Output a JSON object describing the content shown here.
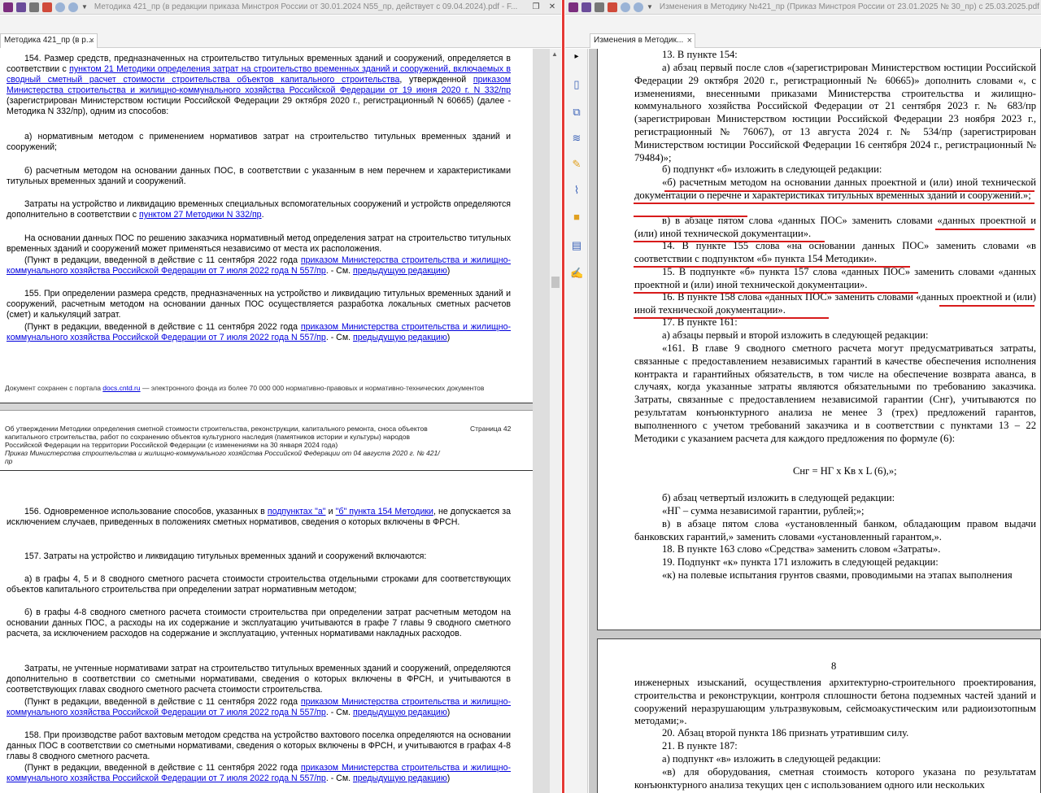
{
  "left_window": {
    "title": "Методика 421_пр (в редакции приказа Минстроя России от 30.01.2024 N55_пр, действует с 09.04.2024).pdf - F...",
    "tab_label": "Методика 421_пр (в р...",
    "tab_close": "×"
  },
  "right_window": {
    "title": "Изменения в Методику №421_пр (Приказ Минстроя России от 23.01.2025 № 30_пр) с 25.03.2025.pdf - Fo...",
    "tab_label": "Изменения в Методик...",
    "tab_close": "×"
  },
  "window_buttons": {
    "restore": "❐",
    "close": "✕"
  },
  "icons": {
    "app": "foxit-app-icon",
    "save": "save-icon",
    "print": "print-icon",
    "undo": "undo-icon",
    "redo": "redo-icon",
    "customize": "chevron-down-icon",
    "expand": "chevron-right-icon",
    "tools": [
      "page-icon",
      "pages-icon",
      "layers-icon",
      "comments-icon",
      "attachment-icon",
      "lock-icon",
      "form-icon",
      "signature-icon"
    ]
  },
  "left_doc": {
    "p154_a": "154. Размер средств, предназначенных на строительство титульных временных зданий и сооружений, определяется в соответствии с ",
    "p154_link1": "пунктом 21 Методики определения затрат на строительство временных зданий и сооружений, включаемых в сводный сметный расчет стоимости строительства объектов капитального строительства",
    "p154_b": ", утвержденной ",
    "p154_link2": "приказом Министерства строительства и жилищно-коммунального хозяйства Российской Федерации от 19 июня 2020 г. N 332/пр",
    "p154_c": " (зарегистрирован Министерством юстиции Российской Федерации 29 октября 2020 г., регистрационный N 60665) (далее - Методика N 332/пр), одним из способов:",
    "p154_item_a": "а) нормативным методом с применением нормативов затрат на строительство титульных временных зданий и сооружений;",
    "p154_item_b": "б) расчетным методом на основании данных ПОС, в соответствии с указанным в нем перечнем и характеристиками титульных временных зданий и сооружений.",
    "p_costs_a": "Затраты на устройство и ликвидацию временных специальных вспомогательных сооружений и устройств определяются дополнительно в соответствии с ",
    "p_costs_link": "пунктом 27 Методики N 332/пр",
    "p_costs_b": ".",
    "p_pos": "На основании данных ПОС по решению заказчика нормативный метод определения затрат на строительство титульных временных зданий и сооружений может применяться независимо от места их расположения.",
    "edit_note_a": "(Пункт в редакции, введенной в действие с 11 сентября 2022 года ",
    "edit_note_link": "приказом Министерства строительства и жилищно-коммунального хозяйства Российской Федерации от 7 июля 2022 года N 557/пр",
    "edit_note_b": ". - См. ",
    "edit_note_prev": "предыдущую редакцию",
    "edit_note_c": ")",
    "p155": "155. При определении размера средств, предназначенных на устройство и ликвидацию титульных временных зданий и сооружений, расчетным методом на основании данных ПОС осуществляется разработка локальных сметных расчетов (смет) и калькуляций затрат.",
    "footer_a": "Документ сохранен с портала ",
    "footer_link": "docs.cntd.ru",
    "footer_b": " — электронного фонда из более 70 000 000 нормативно-правовых и нормативно-технических документов",
    "running_head": "Об утверждении Методики определения сметной стоимости строительства, реконструкции, капитального ремонта, сноса объектов капитального строительства, работ по сохранению объектов культурного наследия (памятников истории и культуры) народов Российской Федерации на территории Российской Федерации (с изменениями на 30 января 2024 года)",
    "running_head_italic": "Приказ Министерства строительства и жилищно-коммунального хозяйства Российской Федерации от 04 августа 2020 г. № 421/пр",
    "page_label": "Страница 42",
    "p156_a": "156. Одновременное использование способов, указанных в ",
    "p156_link1": "подпунктах \"а\"",
    "p156_b": " и ",
    "p156_link2": "\"б\" пункта 154 Методики",
    "p156_c": ", не допускается за исключением случаев, приведенных в положениях сметных нормативов, сведения о которых включены в ФРСН.",
    "p157": "157. Затраты на устройство и ликвидацию титульных временных зданий и сооружений включаются:",
    "p157_a": "а) в графы 4, 5 и 8 сводного сметного расчета стоимости строительства отдельными строками для соответствующих объектов капитального строительства при определении затрат нормативным методом;",
    "p157_b": "б) в графы 4-8 сводного сметного расчета стоимости строительства при определении затрат расчетным методом на основании данных ПОС, а расходы на их содержание и эксплуатацию учитываются в графе 7 главы 9 сводного сметного расчета, за исключением расходов на содержание и эксплуатацию, учтенных нормативами накладных расходов.",
    "p157_c": "Затраты, не учтенные нормативами затрат на строительство титульных временных зданий и сооружений, определяются дополнительно в соответствии со сметными нормативами, сведения о которых включены в ФРСН, и учитываются в соответствующих главах сводного сметного расчета стоимости строительства.",
    "p158": "158. При производстве работ вахтовым методом средства на устройство вахтового поселка определяются на основании данных ПОС в соответствии со сметными нормативами, сведения о которых включены в ФРСН, и учитываются в графах 4-8 главы 8 сводного сметного расчета."
  },
  "right_doc": {
    "l13": "13. В пункте 154:",
    "l13a": "а) абзац первый после слов «(зарегистрирован Министерством юстиции Российской Федерации 29 октября 2020 г., регистрационный № 60665)» дополнить словами «, с изменениями, внесенными приказами Министерства строительства и жилищно-коммунального хозяйства Российской Федерации от 21 сентября 2023 г. № 683/пр (зарегистрирован Министерством юстиции Российской Федерации 23 ноября 2023 г., регистрационный № 76067), от 13 августа 2024 г. № 534/пр (зарегистрирован Министерством юстиции Российской Федерации 16 сентября 2024 г., регистрационный № 79484)»;",
    "l13b": "б) подпункт «б» изложить в следующей редакции:",
    "l13b_q": "«б) расчетным методом на основании данных проектной и (или) иной технической документации о перечне и характеристиках титульных временных зданий и сооружений.»;",
    "l13v": "в) в абзаце пятом слова «данных ПОС» заменить словами «данных проектной и (или) иной технической документации».",
    "l14": "14. В пункте 155 слова «на основании данных ПОС» заменить словами «в соответствии с подпунктом «б» пункта 154 Методики».",
    "l15": "15. В подпункте «б» пункта 157 слова «данных ПОС» заменить словами «данных проектной и (или) иной технической документации».",
    "l16": "16. В пункте 158 слова «данных ПОС» заменить словами «данных проектной и (или) иной технической документации».",
    "l17": "17. В пункте 161:",
    "l17a": "а) абзацы первый и второй изложить в следующей редакции:",
    "l161": "«161. В главе 9 сводного сметного расчета могут предусматриваться затраты, связанные с предоставлением независимых гарантий в качестве обеспечения исполнения контракта и гарантийных обязательств, в том числе на обеспечение возврата аванса, в случаях, когда указанные затраты являются обязательными по требованию заказчика. Затраты, связанные с предоставлением независимой гарантии (Снг), учитываются по результатам конъюнктурного анализа не менее 3 (трех) предложений гарантов, выполненного с учетом требований заказчика и в соответствии с пунктами 13 – 22 Методики с указанием расчета для каждого предложения по формуле (6):",
    "formula": "Снг = НГ х Кв х L (6),»;",
    "l17b": "б) абзац четвертый изложить в следующей редакции:",
    "l17b_q": "«НГ – сумма независимой гарантии, рублей;»;",
    "l17v": "в) в абзаце пятом слова «установленный банком, обладающим правом выдачи банковских гарантий,» заменить словами «установленный гарантом,».",
    "l18": "18. В пункте 163 слово «Средства» заменить словом «Затраты».",
    "l19": "19. Подпункт «к» пункта 171 изложить в следующей редакции:",
    "l19k": "«к) на полевые испытания грунтов сваями, проводимыми на этапах выполнения",
    "page2_number": "8",
    "p2_cont": "инженерных изысканий, осуществления архитектурно-строительного проектирования, строительства и реконструкции, контроля сплошности бетона подземных частей зданий и сооружений неразрушающим ультразвуковым, сейсмоакустическим или радиоизотопным методами;».",
    "l20": "20. Абзац второй пункта 186 признать утратившим силу.",
    "l21": "21. В пункте 187:",
    "l21a": "а) подпункт «в» изложить в следующей редакции:",
    "l21v": "«в) для оборудования, сметная стоимость которого указана по результатам конъюнктурного анализа текущих цен с использованием одного или нескольких"
  },
  "colors": {
    "link": "#0000dd",
    "annotation_red": "#d81b1b",
    "divider_red": "#e53935"
  }
}
